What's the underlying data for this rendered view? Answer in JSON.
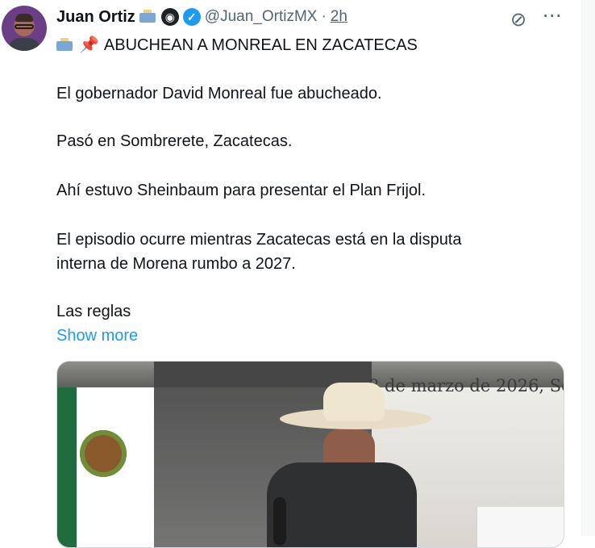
{
  "header": {
    "display_name": "Juan Ortiz",
    "handle": "@Juan_OrtizMX",
    "separator": "·",
    "time": "2h"
  },
  "tweet": {
    "title": "ABUCHEAN A MONREAL EN ZACATECAS",
    "lines": [
      "El gobernador David Monreal fue abucheado.",
      "Pasó en Sombrerete, Zacatecas.",
      "Ahí estuvo Sheinbaum para presentar el Plan Frijol.",
      "El episodio ocurre mientras Zacatecas está en la disputa",
      "interna de Morena rumbo a 2027.",
      "Las reglas"
    ],
    "show_more": "Show more"
  },
  "media": {
    "date_text": "8 de marzo de 2026, So"
  },
  "icons": {
    "mailbox": "mailbox-icon",
    "eye": "eye-icon",
    "verified": "verified-icon",
    "pin": "pushpin-icon",
    "grok": "grok-icon",
    "more": "more-icon"
  },
  "colors": {
    "primary_text": "#0f1419",
    "secondary_text": "#536471",
    "link_blue": "#1d9bf0",
    "border": "#cfd9de"
  }
}
